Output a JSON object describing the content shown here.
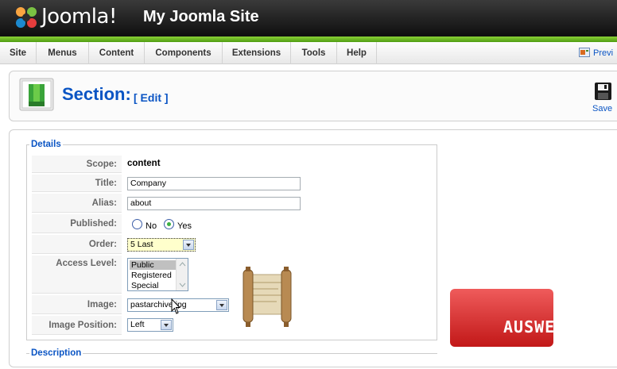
{
  "header": {
    "logo_text": "Joomla!",
    "site_title": "My Joomla Site"
  },
  "menu": [
    {
      "label": "Site"
    },
    {
      "label": "Menus"
    },
    {
      "label": "Content"
    },
    {
      "label": "Components"
    },
    {
      "label": "Extensions"
    },
    {
      "label": "Tools"
    },
    {
      "label": "Help"
    }
  ],
  "preview_label": "Previ",
  "toolbar": {
    "title": "Section:",
    "edit": "[ Edit ]",
    "save_label": "Save"
  },
  "details": {
    "legend": "Details",
    "scope": {
      "label": "Scope:",
      "value": "content"
    },
    "title": {
      "label": "Title:",
      "value": "Company"
    },
    "alias": {
      "label": "Alias:",
      "value": "about"
    },
    "published": {
      "label": "Published:",
      "no": "No",
      "yes": "Yes",
      "selected": "Yes"
    },
    "order": {
      "label": "Order:",
      "value": "5 Last"
    },
    "access": {
      "label": "Access Level:",
      "options": [
        "Public",
        "Registered",
        "Special"
      ],
      "selected": "Public"
    },
    "image": {
      "label": "Image:",
      "value": "pastarchive.jpg"
    },
    "image_position": {
      "label": "Image Position:",
      "value": "Left"
    }
  },
  "description_legend": "Description",
  "watermark": "AUSWEB",
  "colors": {
    "link_blue": "#0b55c4",
    "header_green": "#6bb820",
    "watermark_red": "#d42a2a"
  }
}
